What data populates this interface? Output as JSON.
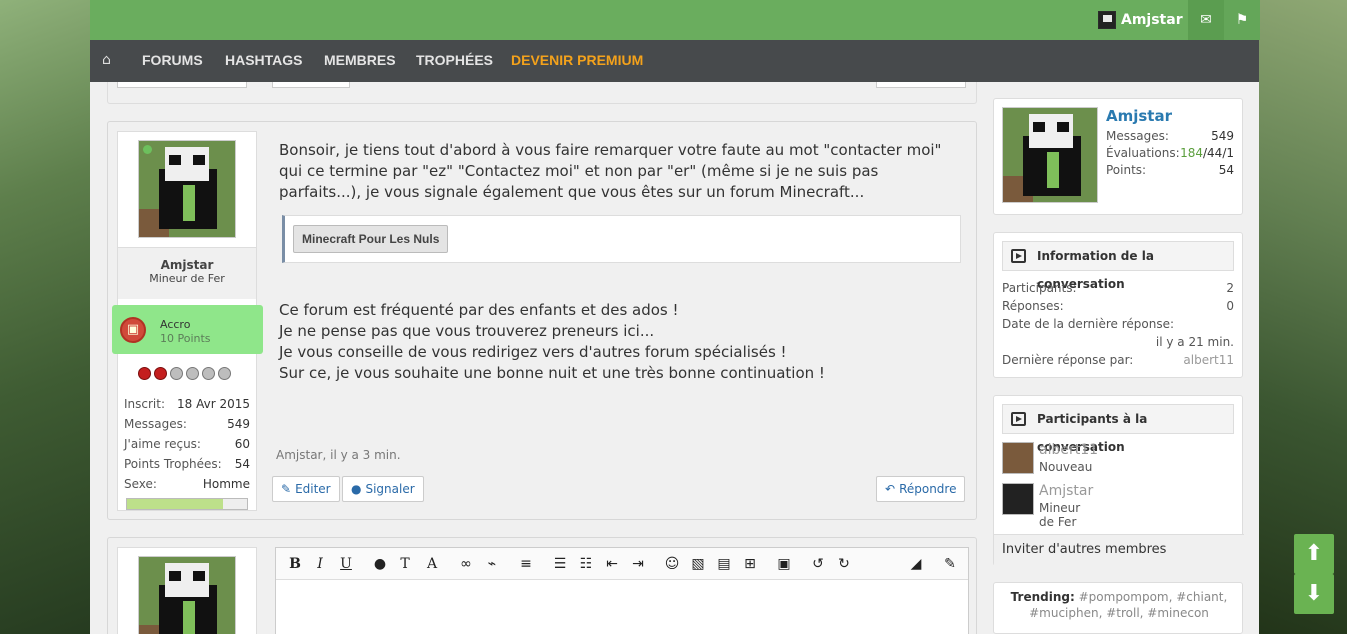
{
  "topbar": {
    "username": "Amjstar",
    "mail_icon": "envelope-icon",
    "flag_icon": "flag-icon"
  },
  "nav": {
    "home_icon": "home-icon",
    "forums": "FORUMS",
    "hashtags": "HASHTAGS",
    "membres": "MEMBRES",
    "trophees": "TROPHÉES",
    "premium": "DEVENIR PREMIUM"
  },
  "post": {
    "author": {
      "name": "Amjstar",
      "title": "Mineur de Fer",
      "rank_name": "Accro",
      "rank_points": "10 Points",
      "apples_filled": 2,
      "apples_total": 6,
      "stats": [
        {
          "label": "Inscrit:",
          "value": "18 Avr 2015"
        },
        {
          "label": "Messages:",
          "value": "549"
        },
        {
          "label": "J'aime reçus:",
          "value": "60"
        },
        {
          "label": "Points Trophées:",
          "value": "54"
        },
        {
          "label": "Sexe:",
          "value": "Homme"
        }
      ]
    },
    "paragraph1": "Bonsoir, je tiens tout d'abord à vous faire remarquer votre faute au mot \"contacter moi\" qui ce termine par \"ez\" \"Contactez moi\" et non par \"er\" (même si je ne suis pas parfaits...), je vous signale également que vous êtes sur un forum Minecraft...",
    "quote_button": "Minecraft Pour Les Nuls",
    "line1": "Ce forum est fréquenté par des enfants et des ados !",
    "line2": "Je ne pense pas que vous trouverez preneurs ici...",
    "line3": "Je vous conseille de vous redirigez vers d'autres forum spécialisés !",
    "line4": "Sur ce, je vous souhaite une bonne nuit et une très bonne continuation !",
    "meta": "Amjstar, il y a 3 min.",
    "actions": {
      "edit": "Editer",
      "report": "Signaler",
      "reply": "Répondre"
    }
  },
  "editor": {
    "tools": [
      "B",
      "I",
      "U",
      "droplet-icon",
      "text-size-icon",
      "A",
      "link-icon",
      "unlink-icon",
      "align-icon",
      "list-icon",
      "ordered-list-icon",
      "outdent-icon",
      "indent-icon",
      "smiley-icon",
      "image-icon",
      "media-icon",
      "insert-icon",
      "save-icon",
      "undo-icon",
      "redo-icon",
      "eraser-icon",
      "wrench-icon"
    ]
  },
  "sidebar": {
    "visitor": {
      "name": "Amjstar",
      "messages_label": "Messages:",
      "messages": "549",
      "ratings_label": "Évaluations:",
      "ratings_pos": "184",
      "ratings_rest": "/44/1",
      "points_label": "Points:",
      "points": "54"
    },
    "conv_info": {
      "title": "Information de la conversation",
      "participants_label": "Participants:",
      "participants": "2",
      "replies_label": "Réponses:",
      "replies": "0",
      "last_date_label": "Date de la dernière réponse:",
      "last_date": "il y a 21 min.",
      "last_by_label": "Dernière réponse par:",
      "last_by": "albert11"
    },
    "participants": {
      "title": "Participants à la conversation",
      "list": [
        {
          "name": "albert11",
          "title": "Nouveau"
        },
        {
          "name": "Amjstar",
          "title": "Mineur de Fer"
        }
      ],
      "invite": "Inviter d'autres membres"
    },
    "trending": {
      "label": "Trending:",
      "tags": "#pompompom, #chiant, #muciphen, #troll, #minecon"
    }
  },
  "colors": {
    "topbar": "#6aad5e",
    "navbar": "#474a4c",
    "premium": "#f4a21b",
    "link": "#2a7ab0",
    "rank_bg": "#8fe68a",
    "scroll_btn": "#6ab352"
  }
}
